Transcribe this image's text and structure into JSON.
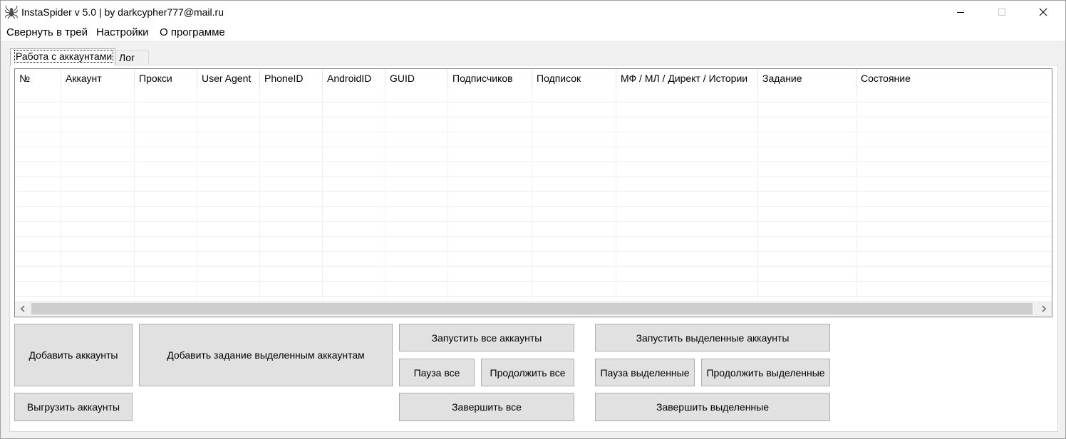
{
  "window": {
    "title": "InstaSpider v 5.0 | by darkcypher777@mail.ru",
    "icon": "spider-icon"
  },
  "menu": {
    "items": [
      "Свернуть в трей",
      "Настройки",
      "О программе"
    ]
  },
  "tabs": [
    {
      "label": "Работа с аккаунтами",
      "active": true
    },
    {
      "label": "Лог",
      "active": false
    }
  ],
  "table": {
    "columns": [
      "№",
      "Аккаунт",
      "Прокси",
      "User Agent",
      "PhoneID",
      "AndroidID",
      "GUID",
      "Подписчиков",
      "Подписок",
      "МФ / МЛ / Директ / Истории",
      "Задание",
      "Состояние"
    ],
    "rows": []
  },
  "buttons": {
    "add_accounts": "Добавить аккаунты",
    "export_accounts": "Выгрузить аккаунты",
    "add_task_selected": "Добавить задание выделенным аккаунтам",
    "start_all": "Запустить все аккаунты",
    "pause_all": "Пауза все",
    "resume_all": "Продолжить все",
    "finish_all": "Завершить все",
    "start_selected": "Запустить выделенные аккаунты",
    "pause_selected": "Пауза выделенные",
    "resume_selected": "Продолжить выделенные",
    "finish_selected": "Завершить выделенные"
  },
  "colors": {
    "window_bg": "#f0f0f0",
    "button_bg": "#e1e1e1",
    "button_border": "#adadad",
    "scroll_thumb": "#cdcdcd"
  }
}
